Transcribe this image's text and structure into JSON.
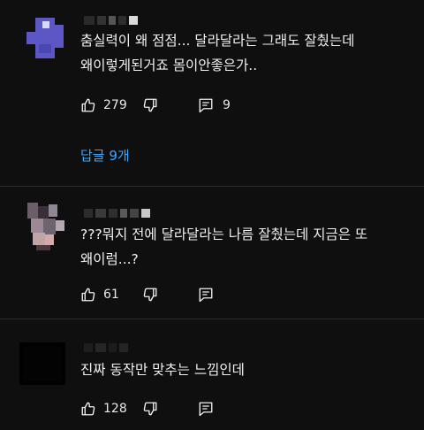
{
  "comments": [
    {
      "text": "춤실력이 왜 점점... 달라달라는 그래도 잘췄는데\n왜이렇게된거죠 몸이안좋은가..",
      "likes": "279",
      "reply_count": "9",
      "replies_link": "답글 9개"
    },
    {
      "text": "???뭐지 전에 달라달라는 나름 잘췄는데 지금은 또\n왜이럼...?",
      "likes": "61"
    },
    {
      "text": "진짜 동작만 맞추는 느낌인데",
      "likes": "128"
    }
  ],
  "icons": {
    "like": "thumbs-up-icon",
    "dislike": "thumbs-down-icon",
    "reply": "reply-icon",
    "more": "more-vertical-icon"
  },
  "colors": {
    "background": "#0f0f0f",
    "text": "#f1f1f1",
    "link": "#3ea6ff",
    "divider": "#2c2c2c"
  }
}
